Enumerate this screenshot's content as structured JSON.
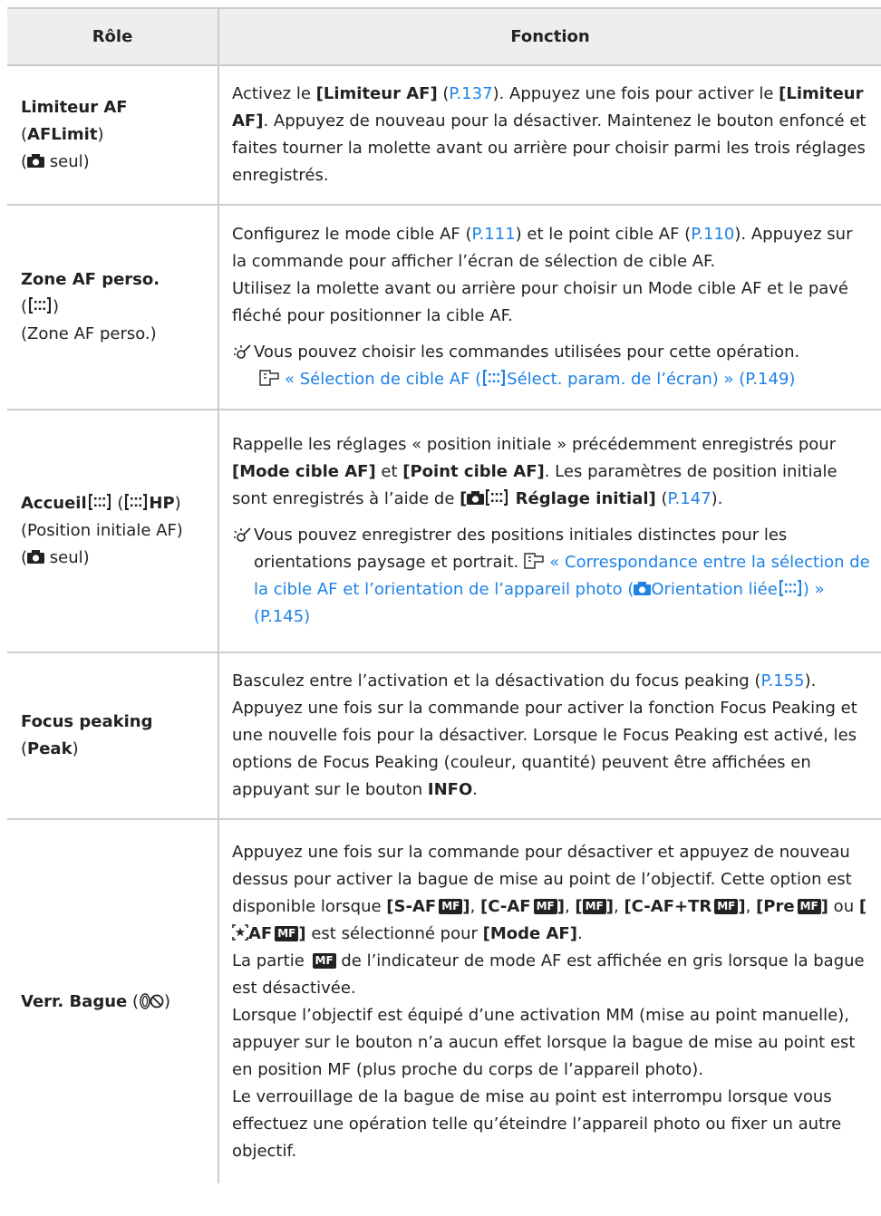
{
  "header": {
    "col1": "Rôle",
    "col2": "Fonction"
  },
  "row1": {
    "name": "Limiteur AF",
    "code": "AFLimit",
    "restrict_suffix": "seul",
    "f1": "Activez le ",
    "f2": "[Limiteur AF]",
    "f3": " (",
    "f4": "P.137",
    "f5": "). Appuyez une fois pour activer le ",
    "f6": "[Limiteur AF]",
    "f7": ". Appuyez de nouveau pour la désactiver. Maintenez le bouton enfoncé et faites tourner la molette avant ou arrière pour choisir parmi les trois réglages enregistrés."
  },
  "row2": {
    "name": "Zone AF perso.",
    "sub": "(Zone AF perso.)",
    "a1": "Configurez le mode cible AF (",
    "a2": "P.111",
    "a3": ") et le point cible AF (",
    "a4": "P.110",
    "a5": "). Appuyez sur la commande pour afficher l’écran de sélection de cible AF.",
    "b1": "Utilisez la molette avant ou arrière pour choisir un Mode cible AF et le pavé fléché pour positionner la cible AF.",
    "note": "Vous pouvez choisir les commandes utilisées pour cette opération.",
    "ref1": "« Sélection de cible AF (",
    "ref2": "Sélect. param. de l’écran) » (P.149)"
  },
  "row3": {
    "name": "Accueil",
    "code_suffix": "HP",
    "sub": "(Position initiale AF)",
    "restrict_suffix": "seul",
    "a1": "Rappelle les réglages « position initiale » précédemment enregistrés pour ",
    "a2": "[Mode cible AF]",
    "a3": " et ",
    "a4": "[Point cible AF]",
    "a5": ". Les paramètres de position initiale sont enregistrés à l’aide de ",
    "a6": "Réglage initial]",
    "a7": " (",
    "a8": "P.147",
    "a9": ").",
    "note": "Vous pouvez enregistrer des positions initiales distinctes pour les orientations paysage et portrait.",
    "ref1": "« Correspondance entre la sélection de la cible AF et l’orientation de l’appareil photo (",
    "ref2": "Orientation liée",
    "ref3": ") » (P.145)"
  },
  "row4": {
    "name": "Focus peaking",
    "code": "Peak",
    "a1": "Basculez entre l’activation et la désactivation du focus peaking (",
    "a2": "P.155",
    "a3": ").",
    "b1": "Appuyez une fois sur la commande pour activer la fonction Focus Peaking et une nouvelle fois pour la désactiver. Lorsque le Focus Peaking est activé, les options de Focus Peaking (couleur, quantité) peuvent être affichées en appuyant sur le bouton ",
    "b2": "INFO",
    "b3": "."
  },
  "row5": {
    "name": "Verr. Bague",
    "a1": "Appuyez une fois sur la commande pour désactiver et appuyez de nouveau dessus pour activer la bague de mise au point de l’objectif. Cette option est disponible lorsque ",
    "o1": "[S-AF",
    "o2": "[C-AF",
    "o3": "[C-AF+TR",
    "o4": "[Pre",
    "o5": "AF",
    "mf": "MF",
    "or_word": " ou ",
    "a2": " est sélectionné pour ",
    "a3": "[Mode AF]",
    "a4": ".",
    "b1": "La partie ",
    "b2": " de l’indicateur de mode AF est affichée en gris lorsque la bague est désactivée.",
    "c1": "Lorsque l’objectif est équipé d’une activation MM (mise au point manuelle), appuyer sur le bouton n’a aucun effet lorsque la bague de mise au point est en position MF (plus proche du corps de l’appareil photo).",
    "d1": "Le verrouillage de la bague de mise au point est interrompu lorsque vous effectuez une opération telle qu’éteindre l’appareil photo ou fixer un autre objectif."
  },
  "colors": {
    "link": "#1e82e6",
    "header_bg": "#eeeeee",
    "border": "#cccccc"
  },
  "icons": [
    "camera-icon",
    "af-target-icon",
    "note-icon",
    "reference-icon",
    "focus-ring-icon",
    "star-af-icon"
  ]
}
